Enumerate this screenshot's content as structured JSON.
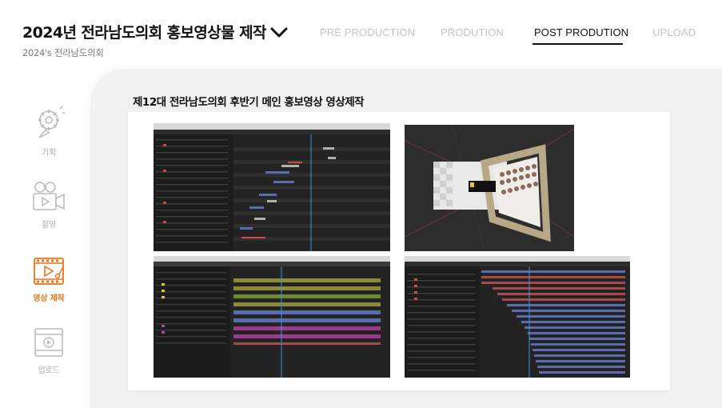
{
  "header": {
    "title": "2024년 전라남도의회 홍보영상물 제작",
    "subtitle": "2024's 전라남도의회"
  },
  "nav": {
    "tabs": [
      {
        "label": "PRE PRODUCTION",
        "active": false
      },
      {
        "label": "PRODUTION",
        "active": false
      },
      {
        "label": "POST PRODUTION",
        "active": true
      },
      {
        "label": "UPLOAD",
        "active": false
      }
    ]
  },
  "sidebar": {
    "items": [
      {
        "label": "기획",
        "icon": "idea-gear-icon",
        "active": false
      },
      {
        "label": "촬영",
        "icon": "video-camera-icon",
        "active": false
      },
      {
        "label": "영상 제작",
        "icon": "video-editing-icon",
        "active": true
      },
      {
        "label": "업로드",
        "icon": "upload-video-icon",
        "active": false
      }
    ]
  },
  "main": {
    "section_title": "제12대 전라남도의회 후반기 메인 홍보영상 영상제작",
    "screenshots": [
      {
        "name": "after-effects-timeline-screenshot"
      },
      {
        "name": "3d-scene-render-screenshot"
      },
      {
        "name": "after-effects-layers-screenshot"
      },
      {
        "name": "after-effects-keyframes-screenshot"
      }
    ]
  },
  "colors": {
    "accent": "#e8741c",
    "inactive": "#c4c4c4",
    "panel": "#f1f1f1"
  }
}
